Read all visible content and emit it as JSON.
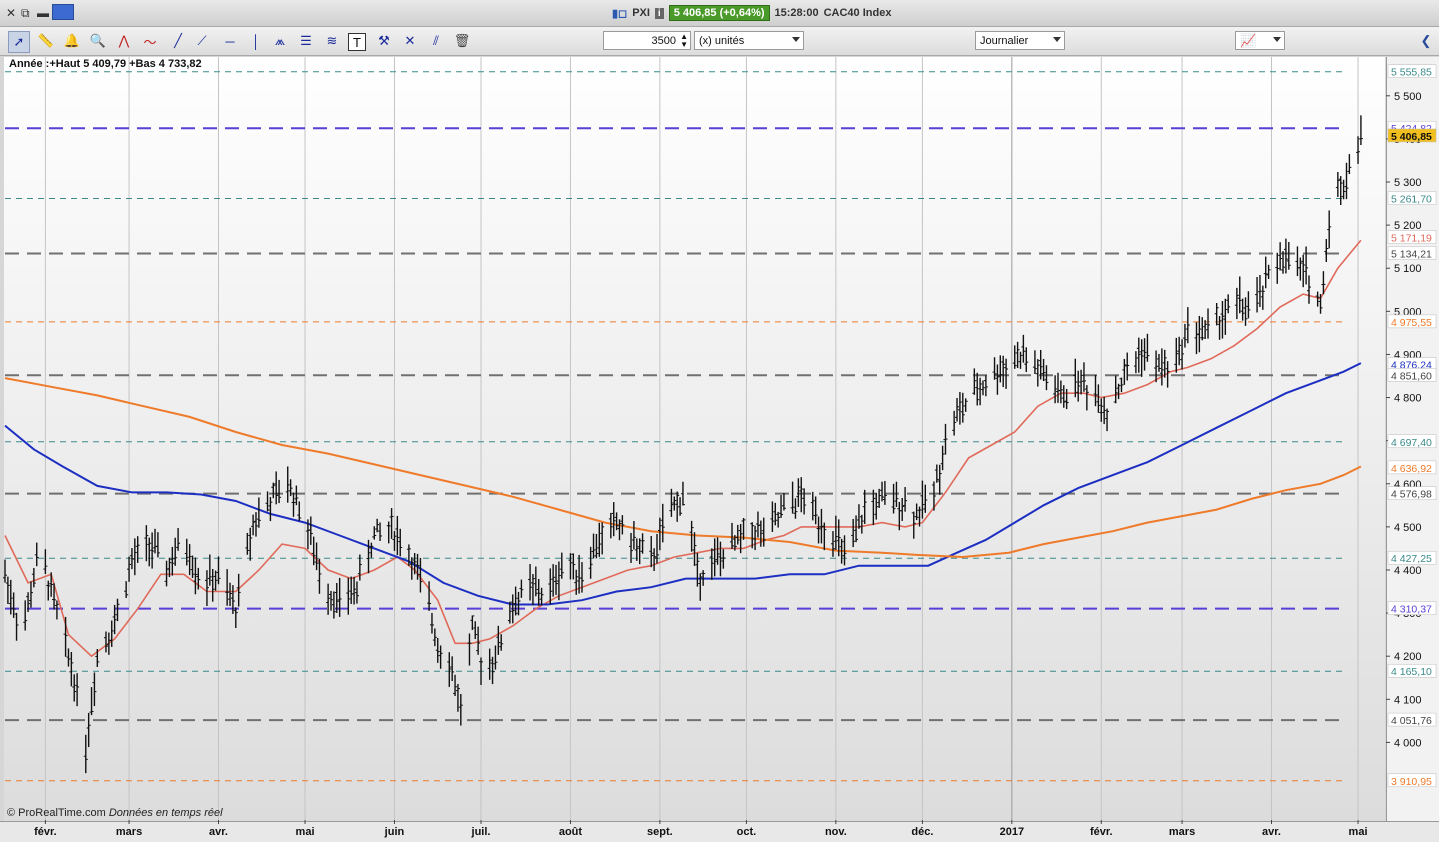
{
  "window": {
    "ticker_label": "PXI",
    "quote": "5 406,85 (+0,64%)",
    "time": "15:28:00",
    "instrument": "CAC40 Index"
  },
  "toolbar": {
    "units_value": "3500",
    "units_label": "(x) unités",
    "period_label": "Journalier"
  },
  "chart_info": "Année :+Haut 5 409,79 +Bas 4 733,82",
  "credit": {
    "brand": "© ProRealTime.com",
    "note": "Données en temps réel"
  },
  "colors": {
    "price": "#111111",
    "ma_short": "#e06a5a",
    "ma_mid": "#1c2fc2",
    "ma_long": "#ee7a2a",
    "level_purple": "#5a3ed6",
    "level_gray": "#707070",
    "level_teal": "#3a8a8a",
    "level_orange": "#ee7a2a",
    "tag_current": "#f2c01e"
  },
  "chart_data": {
    "type": "line",
    "title": "",
    "ylim": [
      3820,
      5590
    ],
    "xlim_days": [
      0,
      469
    ],
    "yticks": [
      {
        "v": 5500,
        "label": "5 500"
      },
      {
        "v": 5400,
        "label": "5 400"
      },
      {
        "v": 5300,
        "label": "5 300"
      },
      {
        "v": 5200,
        "label": "5 200"
      },
      {
        "v": 5100,
        "label": "5 100"
      },
      {
        "v": 5000,
        "label": "5 000"
      },
      {
        "v": 4900,
        "label": "4 900"
      },
      {
        "v": 4800,
        "label": "4 800"
      },
      {
        "v": 4700,
        "label": "4 700"
      },
      {
        "v": 4600,
        "label": "4 600"
      },
      {
        "v": 4500,
        "label": "4 500"
      },
      {
        "v": 4400,
        "label": "4 400"
      },
      {
        "v": 4300,
        "label": "4 300"
      },
      {
        "v": 4200,
        "label": "4 200"
      },
      {
        "v": 4100,
        "label": "4 100"
      },
      {
        "v": 4000,
        "label": "4 000"
      }
    ],
    "xticks": [
      {
        "d": 14,
        "label": "févr."
      },
      {
        "d": 43,
        "label": "mars"
      },
      {
        "d": 74,
        "label": "avr."
      },
      {
        "d": 104,
        "label": "mai"
      },
      {
        "d": 135,
        "label": "juin"
      },
      {
        "d": 165,
        "label": "juil."
      },
      {
        "d": 196,
        "label": "août"
      },
      {
        "d": 227,
        "label": "sept."
      },
      {
        "d": 257,
        "label": "oct."
      },
      {
        "d": 288,
        "label": "nov."
      },
      {
        "d": 318,
        "label": "déc."
      },
      {
        "d": 349,
        "label": "2017"
      },
      {
        "d": 380,
        "label": "févr."
      },
      {
        "d": 408,
        "label": "mars"
      },
      {
        "d": 439,
        "label": "avr."
      },
      {
        "d": 469,
        "label": "mai"
      }
    ],
    "levels": [
      {
        "value": 5555.85,
        "label": "5 555,85",
        "style": "teal-thin"
      },
      {
        "value": 5424.82,
        "label": "5 424,82",
        "style": "purple"
      },
      {
        "value": 5406.85,
        "label": "5 406,85",
        "style": "current"
      },
      {
        "value": 5261.7,
        "label": "5 261,70",
        "style": "teal-thin"
      },
      {
        "value": 5171.19,
        "label": "5 171,19",
        "style": "ma-short"
      },
      {
        "value": 5134.21,
        "label": "5 134,21",
        "style": "gray"
      },
      {
        "value": 4975.55,
        "label": "4 975,55",
        "style": "orange-thin"
      },
      {
        "value": 4876.24,
        "label": "4 876,24",
        "style": "ma-mid"
      },
      {
        "value": 4851.6,
        "label": "4 851,60",
        "style": "gray"
      },
      {
        "value": 4697.4,
        "label": "4 697,40",
        "style": "teal-thin"
      },
      {
        "value": 4636.92,
        "label": "4 636,92",
        "style": "ma-long"
      },
      {
        "value": 4576.98,
        "label": "4 576,98",
        "style": "gray"
      },
      {
        "value": 4427.25,
        "label": "4 427,25",
        "style": "teal-thin"
      },
      {
        "value": 4310.37,
        "label": "4 310,37",
        "style": "purple"
      },
      {
        "value": 4165.1,
        "label": "4 165,10",
        "style": "teal-thin"
      },
      {
        "value": 4051.76,
        "label": "4 051,76",
        "style": "gray"
      },
      {
        "value": 3910.95,
        "label": "3 910,95",
        "style": "orange-thin"
      }
    ],
    "series": [
      {
        "key": "price",
        "points": [
          [
            0,
            4390
          ],
          [
            6,
            4250
          ],
          [
            12,
            4450
          ],
          [
            18,
            4300
          ],
          [
            24,
            4150
          ],
          [
            28,
            3990
          ],
          [
            32,
            4200
          ],
          [
            38,
            4280
          ],
          [
            44,
            4420
          ],
          [
            50,
            4460
          ],
          [
            56,
            4400
          ],
          [
            62,
            4470
          ],
          [
            68,
            4370
          ],
          [
            74,
            4380
          ],
          [
            80,
            4310
          ],
          [
            86,
            4510
          ],
          [
            92,
            4560
          ],
          [
            98,
            4600
          ],
          [
            104,
            4520
          ],
          [
            110,
            4370
          ],
          [
            116,
            4320
          ],
          [
            122,
            4360
          ],
          [
            128,
            4480
          ],
          [
            134,
            4500
          ],
          [
            140,
            4440
          ],
          [
            146,
            4340
          ],
          [
            150,
            4230
          ],
          [
            154,
            4190
          ],
          [
            158,
            4080
          ],
          [
            162,
            4260
          ],
          [
            166,
            4170
          ],
          [
            170,
            4200
          ],
          [
            176,
            4320
          ],
          [
            182,
            4360
          ],
          [
            188,
            4340
          ],
          [
            194,
            4420
          ],
          [
            200,
            4390
          ],
          [
            206,
            4470
          ],
          [
            212,
            4510
          ],
          [
            218,
            4460
          ],
          [
            224,
            4420
          ],
          [
            230,
            4530
          ],
          [
            236,
            4580
          ],
          [
            240,
            4390
          ],
          [
            246,
            4420
          ],
          [
            252,
            4450
          ],
          [
            258,
            4500
          ],
          [
            264,
            4480
          ],
          [
            270,
            4540
          ],
          [
            276,
            4570
          ],
          [
            282,
            4520
          ],
          [
            288,
            4470
          ],
          [
            292,
            4420
          ],
          [
            298,
            4540
          ],
          [
            304,
            4560
          ],
          [
            310,
            4560
          ],
          [
            316,
            4530
          ],
          [
            322,
            4580
          ],
          [
            326,
            4700
          ],
          [
            330,
            4760
          ],
          [
            336,
            4810
          ],
          [
            342,
            4850
          ],
          [
            348,
            4880
          ],
          [
            352,
            4900
          ],
          [
            356,
            4880
          ],
          [
            362,
            4840
          ],
          [
            366,
            4800
          ],
          [
            372,
            4840
          ],
          [
            378,
            4810
          ],
          [
            382,
            4770
          ],
          [
            388,
            4850
          ],
          [
            394,
            4910
          ],
          [
            400,
            4870
          ],
          [
            406,
            4880
          ],
          [
            410,
            4960
          ],
          [
            416,
            4950
          ],
          [
            422,
            4990
          ],
          [
            428,
            5020
          ],
          [
            432,
            4990
          ],
          [
            436,
            5050
          ],
          [
            442,
            5130
          ],
          [
            448,
            5100
          ],
          [
            452,
            5080
          ],
          [
            456,
            5010
          ],
          [
            460,
            5280
          ],
          [
            464,
            5290
          ],
          [
            468,
            5380
          ],
          [
            470,
            5406
          ]
        ]
      },
      {
        "key": "ma_short",
        "points": [
          [
            0,
            4480
          ],
          [
            8,
            4370
          ],
          [
            16,
            4390
          ],
          [
            22,
            4250
          ],
          [
            30,
            4200
          ],
          [
            38,
            4240
          ],
          [
            46,
            4310
          ],
          [
            54,
            4390
          ],
          [
            62,
            4390
          ],
          [
            70,
            4350
          ],
          [
            80,
            4350
          ],
          [
            88,
            4400
          ],
          [
            96,
            4460
          ],
          [
            104,
            4450
          ],
          [
            112,
            4400
          ],
          [
            120,
            4380
          ],
          [
            128,
            4400
          ],
          [
            136,
            4430
          ],
          [
            142,
            4400
          ],
          [
            150,
            4330
          ],
          [
            156,
            4230
          ],
          [
            162,
            4230
          ],
          [
            168,
            4240
          ],
          [
            176,
            4270
          ],
          [
            184,
            4310
          ],
          [
            192,
            4340
          ],
          [
            200,
            4360
          ],
          [
            208,
            4380
          ],
          [
            216,
            4400
          ],
          [
            224,
            4410
          ],
          [
            232,
            4430
          ],
          [
            240,
            4440
          ],
          [
            248,
            4450
          ],
          [
            256,
            4450
          ],
          [
            264,
            4470
          ],
          [
            270,
            4480
          ],
          [
            276,
            4500
          ],
          [
            282,
            4500
          ],
          [
            288,
            4500
          ],
          [
            296,
            4500
          ],
          [
            304,
            4510
          ],
          [
            312,
            4500
          ],
          [
            318,
            4510
          ],
          [
            326,
            4580
          ],
          [
            334,
            4660
          ],
          [
            342,
            4690
          ],
          [
            350,
            4720
          ],
          [
            358,
            4780
          ],
          [
            366,
            4810
          ],
          [
            374,
            4810
          ],
          [
            380,
            4800
          ],
          [
            388,
            4810
          ],
          [
            396,
            4830
          ],
          [
            404,
            4860
          ],
          [
            410,
            4870
          ],
          [
            418,
            4890
          ],
          [
            426,
            4920
          ],
          [
            434,
            4960
          ],
          [
            442,
            5010
          ],
          [
            450,
            5040
          ],
          [
            456,
            5030
          ],
          [
            462,
            5100
          ],
          [
            470,
            5165
          ]
        ]
      },
      {
        "key": "ma_mid",
        "points": [
          [
            0,
            4735
          ],
          [
            10,
            4680
          ],
          [
            20,
            4640
          ],
          [
            32,
            4595
          ],
          [
            44,
            4580
          ],
          [
            56,
            4580
          ],
          [
            68,
            4575
          ],
          [
            80,
            4560
          ],
          [
            92,
            4530
          ],
          [
            104,
            4510
          ],
          [
            116,
            4480
          ],
          [
            128,
            4450
          ],
          [
            140,
            4420
          ],
          [
            152,
            4370
          ],
          [
            164,
            4340
          ],
          [
            176,
            4320
          ],
          [
            188,
            4320
          ],
          [
            200,
            4330
          ],
          [
            212,
            4350
          ],
          [
            224,
            4360
          ],
          [
            236,
            4380
          ],
          [
            248,
            4380
          ],
          [
            260,
            4380
          ],
          [
            272,
            4390
          ],
          [
            284,
            4390
          ],
          [
            296,
            4410
          ],
          [
            308,
            4410
          ],
          [
            320,
            4410
          ],
          [
            330,
            4440
          ],
          [
            340,
            4470
          ],
          [
            350,
            4510
          ],
          [
            360,
            4550
          ],
          [
            372,
            4590
          ],
          [
            384,
            4620
          ],
          [
            396,
            4650
          ],
          [
            408,
            4690
          ],
          [
            420,
            4730
          ],
          [
            432,
            4770
          ],
          [
            444,
            4810
          ],
          [
            456,
            4840
          ],
          [
            464,
            4860
          ],
          [
            470,
            4880
          ]
        ]
      },
      {
        "key": "ma_long",
        "points": [
          [
            0,
            4845
          ],
          [
            16,
            4825
          ],
          [
            32,
            4805
          ],
          [
            48,
            4780
          ],
          [
            64,
            4755
          ],
          [
            80,
            4720
          ],
          [
            96,
            4690
          ],
          [
            112,
            4670
          ],
          [
            128,
            4645
          ],
          [
            144,
            4620
          ],
          [
            160,
            4595
          ],
          [
            176,
            4570
          ],
          [
            192,
            4540
          ],
          [
            208,
            4510
          ],
          [
            224,
            4490
          ],
          [
            240,
            4480
          ],
          [
            256,
            4475
          ],
          [
            272,
            4465
          ],
          [
            288,
            4445
          ],
          [
            304,
            4440
          ],
          [
            316,
            4435
          ],
          [
            332,
            4430
          ],
          [
            348,
            4440
          ],
          [
            360,
            4460
          ],
          [
            372,
            4475
          ],
          [
            384,
            4490
          ],
          [
            396,
            4510
          ],
          [
            408,
            4525
          ],
          [
            420,
            4540
          ],
          [
            432,
            4565
          ],
          [
            444,
            4585
          ],
          [
            456,
            4600
          ],
          [
            464,
            4620
          ],
          [
            470,
            4640
          ]
        ]
      }
    ]
  }
}
